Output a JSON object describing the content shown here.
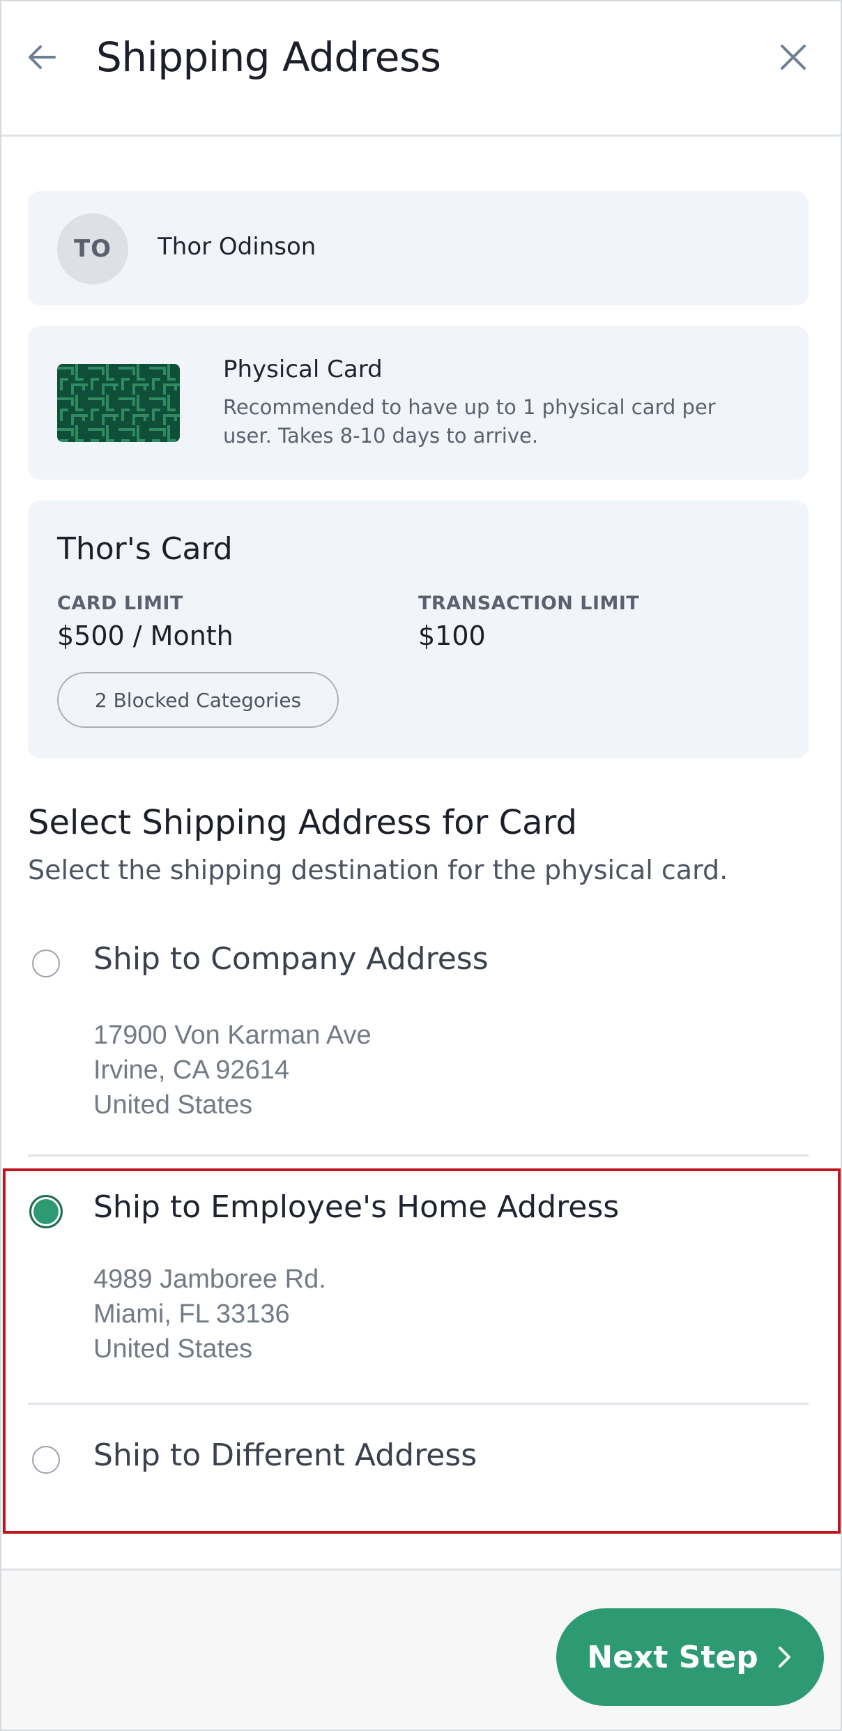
{
  "header": {
    "title": "Shipping Address"
  },
  "user": {
    "initials": "TO",
    "name": "Thor Odinson"
  },
  "card_info": {
    "type": "Physical Card",
    "description": "Recommended to have up to 1 physical card per user. Takes 8-10 days to arrive."
  },
  "card": {
    "name": "Thor's Card",
    "card_limit_label": "CARD LIMIT",
    "card_limit_value": "$500 / Month",
    "transaction_limit_label": "TRANSACTION LIMIT",
    "transaction_limit_value": "$100",
    "blocked_categories": "2 Blocked Categories"
  },
  "shipping": {
    "title": "Select Shipping Address for Card",
    "subtitle": "Select the shipping destination for the physical card.",
    "options": [
      {
        "label": "Ship to Company Address",
        "selected": false,
        "address": [
          "17900 Von Karman Ave",
          "Irvine, CA 92614",
          "United States"
        ]
      },
      {
        "label": "Ship to Employee's Home Address",
        "selected": true,
        "address": [
          "4989 Jamboree Rd.",
          "Miami, FL 33136",
          "United States"
        ]
      },
      {
        "label": "Ship to Different Address",
        "selected": false
      }
    ]
  },
  "footer": {
    "next_label": "Next Step"
  },
  "icons": {
    "back": "arrow-left-icon",
    "close": "close-icon",
    "next": "chevron-right-icon"
  },
  "colors": {
    "accent": "#2e9a73",
    "highlight": "#c0161b",
    "panel": "#f1f4f8"
  }
}
